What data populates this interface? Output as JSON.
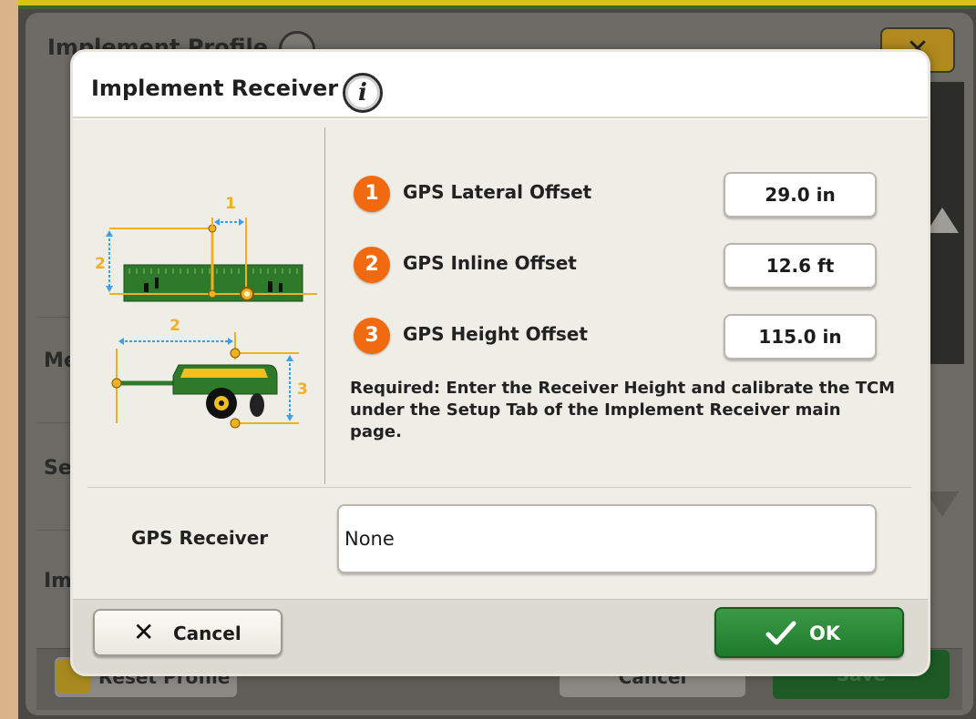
{
  "background": {
    "title": "Implement Profile",
    "rows": [
      "Me",
      "Se",
      "Im"
    ],
    "reset_label": "Reset Profile",
    "cancel_label": "Cancel",
    "save_label": "Save"
  },
  "dialog": {
    "title": "Implement Receiver",
    "info_icon": "info-icon",
    "offsets": [
      {
        "number": "1",
        "label": "GPS Lateral Offset",
        "value": "29.0 in"
      },
      {
        "number": "2",
        "label": "GPS Inline Offset",
        "value": "12.6 ft"
      },
      {
        "number": "3",
        "label": "GPS Height Offset",
        "value": "115.0 in"
      }
    ],
    "note": "Required: Enter the Receiver Height and calibrate the TCM under the Setup Tab of the Implement Receiver main page.",
    "gps_receiver_label": "GPS Receiver",
    "gps_receiver_value": "None",
    "diagram_labels": {
      "top_1": "1",
      "top_2": "2",
      "side_2": "2",
      "side_3": "3"
    },
    "cancel_label": "Cancel",
    "ok_label": "OK"
  },
  "colors": {
    "badge": "#f26a10",
    "ok_green": "#2a8a36",
    "dimension_blue": "#3aa0e8",
    "dimension_orange": "#f0b020",
    "implement_green": "#2f7a2a"
  }
}
